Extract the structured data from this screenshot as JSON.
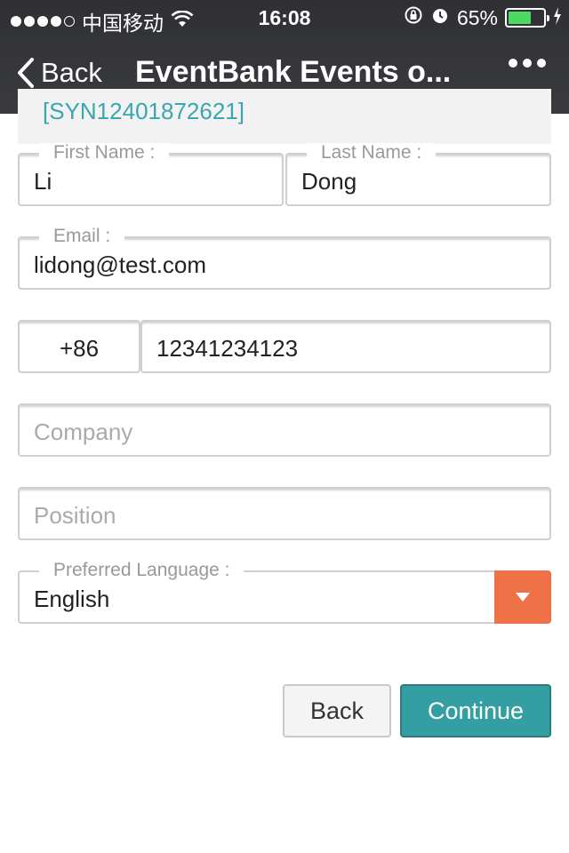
{
  "status_bar": {
    "carrier": "中国移动",
    "time": "16:08",
    "battery": "65%",
    "battery_level": 0.65
  },
  "nav": {
    "back_label": "Back",
    "title": "EventBank Events o...",
    "more_icon": "ellipsis-icon"
  },
  "ticket_info": {
    "partial_text": "[SYN12401872621]"
  },
  "form": {
    "first_name": {
      "label": "First Name :",
      "value": "Li"
    },
    "last_name": {
      "label": "Last Name :",
      "value": "Dong"
    },
    "email": {
      "label": "Email :",
      "value": "lidong@test.com"
    },
    "phone": {
      "country_code": "+86",
      "number": "12341234123"
    },
    "company": {
      "placeholder": "Company",
      "value": ""
    },
    "position": {
      "placeholder": "Position",
      "value": ""
    },
    "language": {
      "label": "Preferred Language :",
      "value": "English"
    }
  },
  "actions": {
    "back_label": "Back",
    "continue_label": "Continue"
  },
  "colors": {
    "accent": "#339fa2",
    "select_button": "#ee7148",
    "battery": "#4cd964"
  }
}
